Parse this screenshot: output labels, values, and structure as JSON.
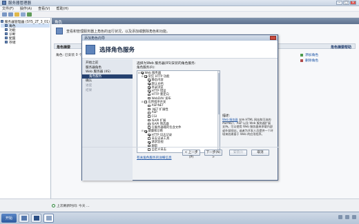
{
  "window": {
    "title": "服务器管理器",
    "menu": [
      "文件(F)",
      "操作(A)",
      "查看(V)",
      "帮助(H)"
    ],
    "content_header": "角色",
    "description": "查看和管理服务器上角色的运行状况，以及添加或删除角色和功能。",
    "summary_title": "角色摘要",
    "summary_help": "角色摘要帮助",
    "roles_line": "角色: 已安装 0 个(共 17 个)",
    "actions": [
      "添加角色",
      "删除角色"
    ],
    "refresh_text": "上次刷新时间: 今天 ..."
  },
  "tree": [
    {
      "label": "服务器管理器 (SYS_2T_3_01)",
      "selected": false
    },
    {
      "label": "角色",
      "selected": true
    },
    {
      "label": "功能",
      "selected": false
    },
    {
      "label": "诊断",
      "selected": false
    },
    {
      "label": "配置",
      "selected": false
    },
    {
      "label": "存储",
      "selected": false
    }
  ],
  "dialog": {
    "title": "添加角色向导",
    "heading": "选择角色服务",
    "nav": [
      {
        "label": "开始之前",
        "sub": false,
        "selected": false,
        "dim": false
      },
      {
        "label": "服务器角色",
        "sub": false,
        "selected": false,
        "dim": false
      },
      {
        "label": "Web 服务器 (IIS)",
        "sub": false,
        "selected": false,
        "dim": false
      },
      {
        "label": "角色服务",
        "sub": true,
        "selected": true,
        "dim": false
      },
      {
        "label": "确认",
        "sub": false,
        "selected": false,
        "dim": false
      },
      {
        "label": "进度",
        "sub": false,
        "selected": false,
        "dim": true
      },
      {
        "label": "结果",
        "sub": false,
        "selected": false,
        "dim": true
      }
    ],
    "intro": "选择为Web 服务器(IIS)安装的角色服务:",
    "services_label": "角色服务(R):",
    "services": [
      {
        "label": "Web 服务器",
        "level": 0,
        "expander": "⊟",
        "checked": true
      },
      {
        "label": "常见 HTTP 功能",
        "level": 1,
        "expander": "⊟",
        "checked": true
      },
      {
        "label": "静态内容",
        "level": 2,
        "expander": "",
        "checked": true
      },
      {
        "label": "默认文档",
        "level": 2,
        "expander": "",
        "checked": true
      },
      {
        "label": "目录浏览",
        "level": 2,
        "expander": "",
        "checked": true
      },
      {
        "label": "HTTP 错误",
        "level": 2,
        "expander": "",
        "checked": true
      },
      {
        "label": "HTTP 重定向",
        "level": 2,
        "expander": "",
        "checked": false
      },
      {
        "label": "WebDAV 发布",
        "level": 2,
        "expander": "",
        "checked": false
      },
      {
        "label": "应用程序开发",
        "level": 1,
        "expander": "⊟",
        "checked": false
      },
      {
        "label": "ASP.NET",
        "level": 2,
        "expander": "",
        "checked": false
      },
      {
        "label": ".NET 扩展性",
        "level": 2,
        "expander": "",
        "checked": false
      },
      {
        "label": "ASP",
        "level": 2,
        "expander": "",
        "checked": false
      },
      {
        "label": "CGI",
        "level": 2,
        "expander": "",
        "checked": false
      },
      {
        "label": "ISAPI 扩展",
        "level": 2,
        "expander": "",
        "checked": false
      },
      {
        "label": "ISAPI 筛选器",
        "level": 2,
        "expander": "",
        "checked": false
      },
      {
        "label": "在服务器端的包含文件",
        "level": 2,
        "expander": "",
        "checked": false
      },
      {
        "label": "健康和诊断",
        "level": 1,
        "expander": "⊟",
        "checked": true
      },
      {
        "label": "HTTP 日志记录",
        "level": 2,
        "expander": "",
        "checked": true
      },
      {
        "label": "日志记录工具",
        "level": 2,
        "expander": "",
        "checked": false
      },
      {
        "label": "请求监视",
        "level": 2,
        "expander": "",
        "checked": true
      },
      {
        "label": "跟踪",
        "level": 2,
        "expander": "",
        "checked": false
      },
      {
        "label": "自定义日志",
        "level": 2,
        "expander": "",
        "checked": false
      }
    ],
    "desc_title": "描述:",
    "desc_link": "Web 服务器",
    "desc_text": "支持 HTML 网站和可选的 ASP.NET、ASP 以及 Web 服务器扩展支持。可以使用 Web 服务器来承载内部或外部网站，或者为开发人员提供一个环境来创建基于 Web 的应用程序。",
    "more_link": "有关角色服务的详细信息",
    "buttons": {
      "prev": "< 上一步(P)",
      "next": "下一步(N) >",
      "install": "安装(I)",
      "cancel": "取消"
    }
  },
  "taskbar": {
    "start": "开始"
  }
}
